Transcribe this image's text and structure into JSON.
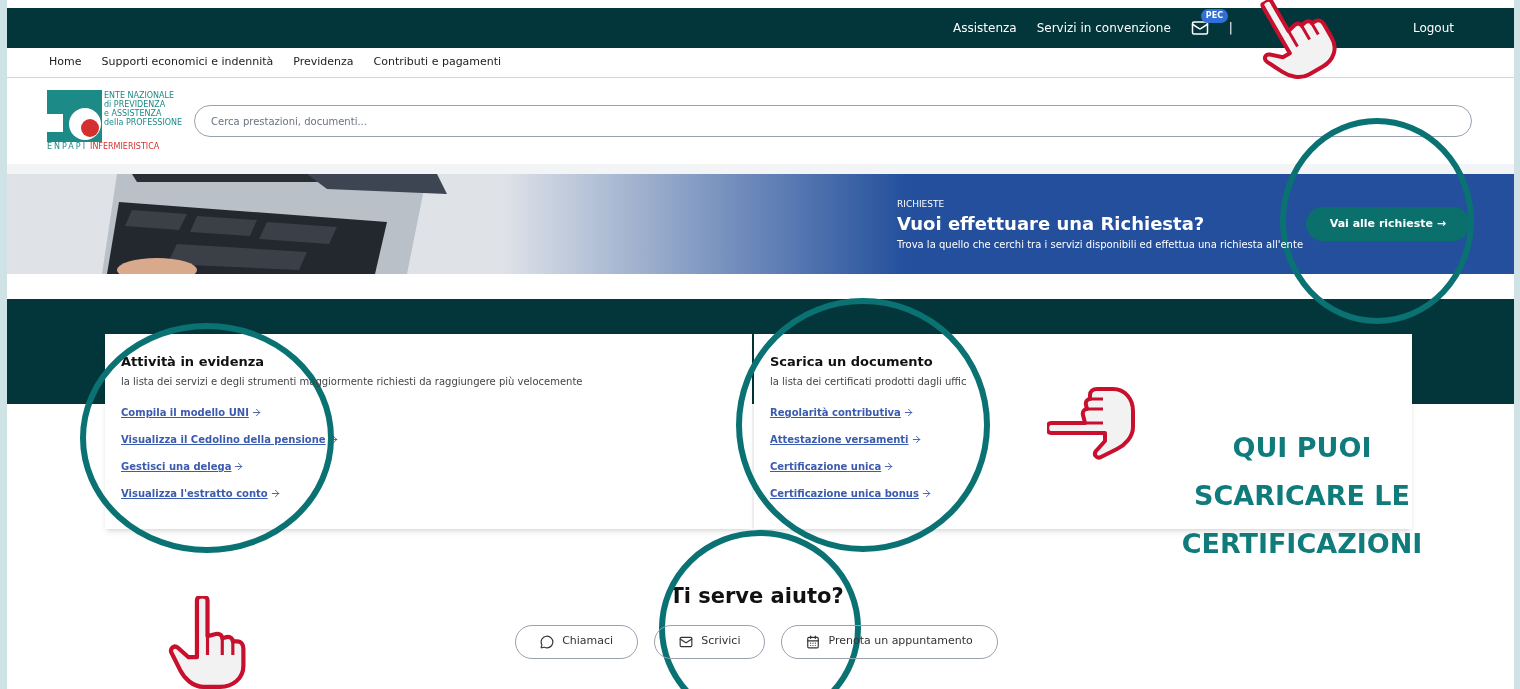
{
  "top_bar": {
    "links": [
      "Assistenza",
      "Servizi in convenzione"
    ],
    "mail_badge": "PEC",
    "separator": "|",
    "logout": "Logout"
  },
  "nav": {
    "items": [
      "Home",
      "Supporti economici e indennità",
      "Previdenza",
      "Contributi e pagamenti"
    ]
  },
  "logo": {
    "lines": [
      "ENTE NAZIONALE",
      "di PREVIDENZA",
      "e ASSISTENZA",
      "della PROFESSIONE"
    ],
    "acronym": "ENPAPI",
    "last_line": "INFERMIERISTICA"
  },
  "search": {
    "placeholder": "Cerca prestazioni, documenti..."
  },
  "banner": {
    "eyebrow": "RICHIESTE",
    "title": "Vuoi effettuare una Richiesta?",
    "text": "Trova la quello che cerchi tra i servizi disponibili ed effettua una richiesta all'ente",
    "button": "Vai alle richieste →"
  },
  "cards": [
    {
      "title": "Attività in evidenza",
      "subtitle": "la lista dei servizi e degli strumenti maggiormente richiesti da raggiungere più velocemente",
      "links": [
        "Compila il modello UNI",
        "Visualizza il Cedolino della pensione",
        "Gestisci una delega",
        "Visualizza l'estratto conto"
      ]
    },
    {
      "title": "Scarica un documento",
      "subtitle": "la lista dei certificati prodotti dagli uffic",
      "links": [
        "Regolarità contributiva",
        "Attestazione versamenti",
        "Certificazione unica",
        "Certificazione unica bonus"
      ]
    }
  ],
  "help": {
    "title": "Ti serve aiuto?",
    "buttons": [
      {
        "kind": "chat",
        "label": "Chiamaci"
      },
      {
        "kind": "mail",
        "label": "Scrivici"
      },
      {
        "kind": "calendar",
        "label": "Prenota un appuntamento"
      }
    ]
  },
  "annotation": {
    "lines": [
      "QUI PUOI",
      "SCARICARE LE",
      "CERTIFICAZIONI"
    ]
  }
}
